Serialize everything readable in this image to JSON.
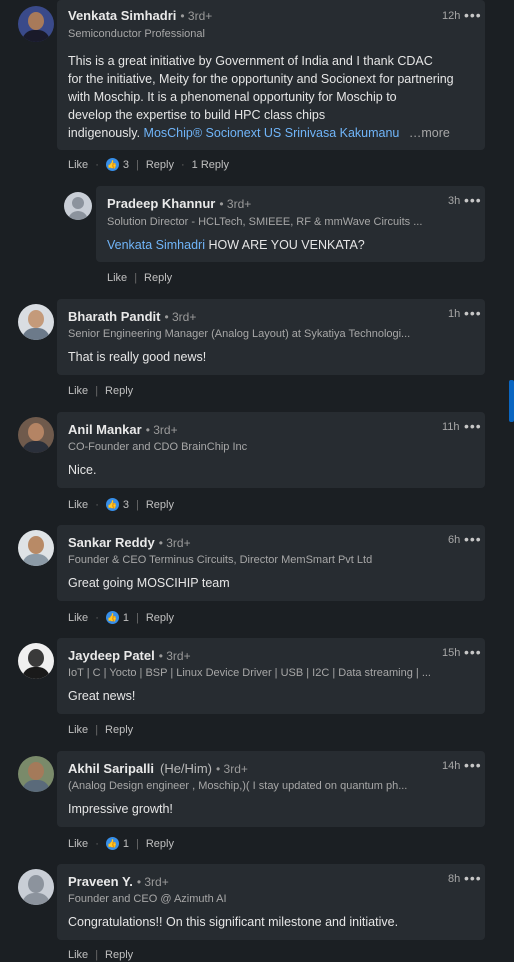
{
  "comments": [
    {
      "name": "Venkata Simhadri",
      "degree": "• 3rd+",
      "headline": "Semiconductor Professional",
      "time": "12h",
      "more_icon": "•••",
      "text_lines": [
        "This is a great initiative by Government of India and I thank CDAC",
        "for the initiative, Meity for the opportunity and Socionext for partnering",
        "with Moschip. It is a phenomenal opportunity for Moschip to",
        "develop the expertise to build HPC class chips"
      ],
      "last_line_text": "indigenously.",
      "mentions": "MosChip® Socionext US Srinivasa Kakumanu",
      "see_more": "…more",
      "like": "Like",
      "reactions": "3",
      "reply": "Reply",
      "replies": "1 Reply"
    },
    {
      "name": "Pradeep Khannur",
      "degree": "• 3rd+",
      "headline": "Solution Director - HCLTech, SMIEEE, RF & mmWave Circuits ...",
      "time": "3h",
      "more_icon": "•••",
      "mention": "Venkata Simhadri",
      "text": "HOW ARE YOU VENKATA?",
      "like": "Like",
      "reply": "Reply"
    },
    {
      "name": "Bharath Pandit",
      "degree": "• 3rd+",
      "headline": "Senior Engineering Manager (Analog Layout) at Sykatiya Technologi...",
      "time": "1h",
      "more_icon": "•••",
      "text": "That is really good news!",
      "like": "Like",
      "reply": "Reply"
    },
    {
      "name": "Anil Mankar",
      "degree": "• 3rd+",
      "headline": "CO-Founder and CDO BrainChip Inc",
      "time": "11h",
      "more_icon": "•••",
      "text": "Nice.",
      "like": "Like",
      "reactions": "3",
      "reply": "Reply"
    },
    {
      "name": "Sankar Reddy",
      "degree": "• 3rd+",
      "headline": "Founder & CEO Terminus Circuits, Director MemSmart Pvt Ltd",
      "time": "6h",
      "more_icon": "•••",
      "text": "Great going MOSCIHIP team",
      "like": "Like",
      "reactions": "1",
      "reply": "Reply"
    },
    {
      "name": "Jaydeep Patel",
      "degree": "• 3rd+",
      "headline": "IoT | C | Yocto | BSP | Linux Device Driver | USB | I2C | Data streaming | ...",
      "time": "15h",
      "more_icon": "•••",
      "text": "Great news!",
      "like": "Like",
      "reply": "Reply"
    },
    {
      "name": "Akhil Saripalli",
      "pronoun": "(He/Him)",
      "degree": "• 3rd+",
      "headline": "(Analog Design engineer , Moschip,)( I stay updated on quantum ph...",
      "time": "14h",
      "more_icon": "•••",
      "text": "Impressive growth!",
      "like": "Like",
      "reactions": "1",
      "reply": "Reply"
    },
    {
      "name": "Praveen Y.",
      "degree": "• 3rd+",
      "headline": "Founder and CEO @ Azimuth AI",
      "time": "8h",
      "more_icon": "•••",
      "text": "Congratulations!! On this significant milestone and initiative.",
      "like": "Like",
      "reply": "Reply"
    }
  ],
  "icons": {
    "like_reaction": "thumbs-up-reaction-icon"
  },
  "colors": {
    "background": "#1b1f23",
    "bubble": "#272c31",
    "link": "#70b5f9",
    "reaction": "#378fe9",
    "scrollbar": "#0a66c2"
  }
}
